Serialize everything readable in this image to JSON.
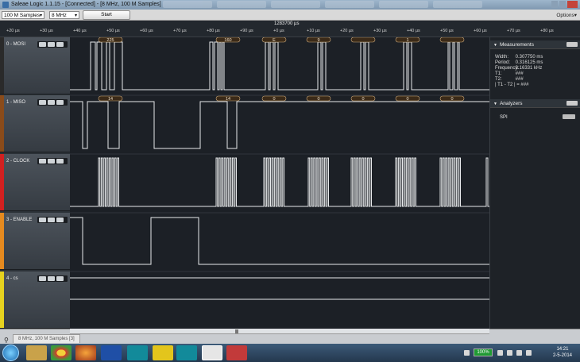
{
  "window": {
    "title": "Saleae Logic 1.1.15 - [Connected] - [8 MHz, 100 M Samples]"
  },
  "toolbar": {
    "samples_value": "100 M Samples",
    "rate_value": "8 MHz",
    "start_label": "Start",
    "options_label": "Options▾"
  },
  "ruler": {
    "center_time": "1283700 µs",
    "ticks": [
      "+20 µs",
      "+30 µs",
      "+40 µs",
      "+50 µs",
      "+60 µs",
      "+70 µs",
      "+80 µs",
      "+90 µs",
      "+0 µs",
      "+10 µs",
      "+20 µs",
      "+30 µs",
      "+40 µs",
      "+50 µs",
      "+60 µs",
      "+70 µs",
      "+80 µs"
    ]
  },
  "channels": [
    {
      "label": "0 - MOSI",
      "color": "#2a2a2a"
    },
    {
      "label": "1 - MISO",
      "color": "#8a4b1a"
    },
    {
      "label": "2 - CLOCK",
      "color": "#d22020"
    },
    {
      "label": "3 - ENABLE",
      "color": "#e58a1f"
    },
    {
      "label": "4 - cs",
      "color": "#e6d21f"
    }
  ],
  "decodes": {
    "mosi": [
      "225",
      "160",
      "E",
      "9",
      "",
      "1",
      ""
    ],
    "miso": [
      "14",
      "14",
      "0",
      "0",
      "0",
      "0",
      "0"
    ]
  },
  "measurements": {
    "header": "Measurements",
    "rows": [
      {
        "k": "Width:",
        "v": "0.307750 ms"
      },
      {
        "k": "Period:",
        "v": "0.316125 ms"
      },
      {
        "k": "Frequency:",
        "v": "3.16331 kHz"
      },
      {
        "k": "T1:",
        "v": "###"
      },
      {
        "k": "T2:",
        "v": "###"
      },
      {
        "k": "| T1 - T2 | =",
        "v": "###"
      }
    ]
  },
  "analyzers": {
    "header": "Analyzers",
    "items": [
      "SPI"
    ]
  },
  "bottom_tab": {
    "label": "8 MHz, 100 M Samples [3]"
  },
  "taskbar": {
    "battery": "100%",
    "time": "14:21",
    "date": "2-5-2014"
  }
}
